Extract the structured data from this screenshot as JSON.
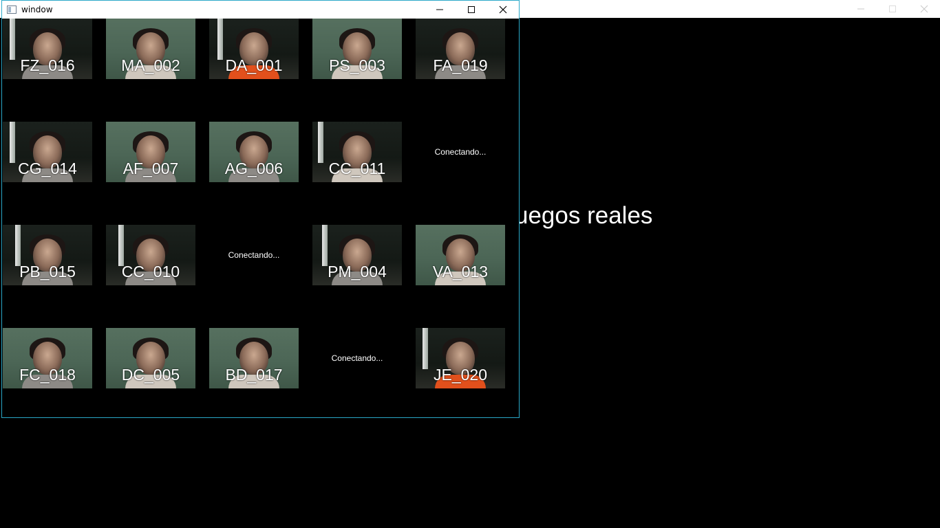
{
  "background_window": {
    "visible_text": "uegos reales"
  },
  "window": {
    "title": "window",
    "border_color": "#2aa8c8"
  },
  "tiles": [
    {
      "label": "FZ_016",
      "state": "feed"
    },
    {
      "label": "MA_002",
      "state": "feed"
    },
    {
      "label": "DA_001",
      "state": "feed"
    },
    {
      "label": "PS_003",
      "state": "feed"
    },
    {
      "label": "FA_019",
      "state": "feed"
    },
    {
      "label": "CG_014",
      "state": "feed"
    },
    {
      "label": "AF_007",
      "state": "feed"
    },
    {
      "label": "AG_006",
      "state": "feed"
    },
    {
      "label": "CC_011",
      "state": "feed"
    },
    {
      "status": "Conectando...",
      "state": "connecting"
    },
    {
      "label": "PB_015",
      "state": "feed"
    },
    {
      "label": "CC_010",
      "state": "feed"
    },
    {
      "status": "Conectando...",
      "state": "connecting"
    },
    {
      "label": "PM_004",
      "state": "feed"
    },
    {
      "label": "VA_013",
      "state": "feed"
    },
    {
      "label": "FC_018",
      "state": "feed"
    },
    {
      "label": "DC_005",
      "state": "feed"
    },
    {
      "label": "BD_017",
      "state": "feed"
    },
    {
      "status": "Conectando...",
      "state": "connecting"
    },
    {
      "label": "JE_020",
      "state": "feed"
    }
  ]
}
